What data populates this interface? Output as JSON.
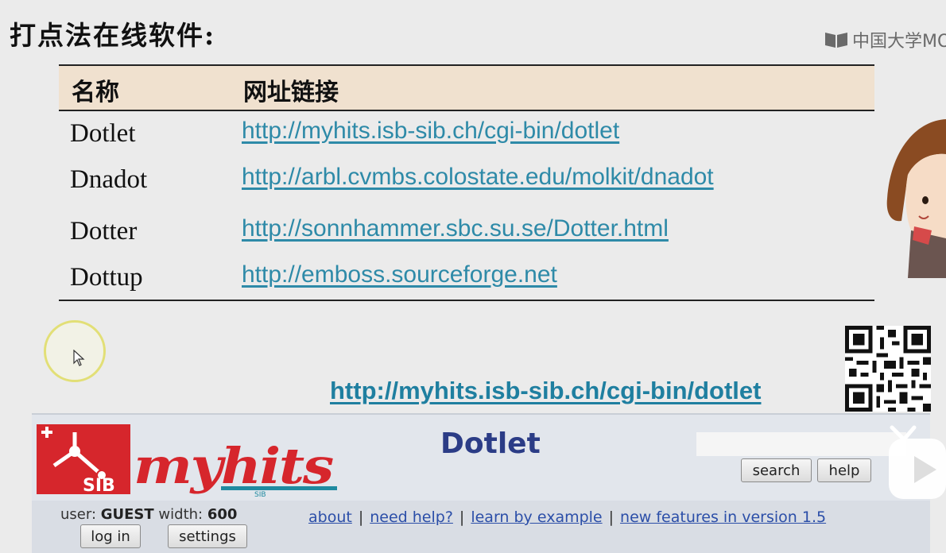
{
  "slide": {
    "title": "打点法在线软件:",
    "brand": "中国大学MO",
    "table": {
      "headers": [
        "名称",
        "网址链接"
      ],
      "rows": [
        {
          "name": "Dotlet",
          "url": "http://myhits.isb-sib.ch/cgi-bin/dotlet"
        },
        {
          "name": "Dnadot",
          "url": "http://arbl.cvmbs.colostate.edu/molkit/dnadot"
        },
        {
          "name": "Dotter",
          "url": "http://sonnhammer.sbc.su.se/Dotter.html"
        },
        {
          "name": "Dottup",
          "url": "http://emboss.sourceforge.net"
        }
      ]
    },
    "highlight_link": "http://myhits.isb-sib.ch/cgi-bin/dotlet"
  },
  "website": {
    "logo_sib": "SIB",
    "logo_myhits": "myhits",
    "logo_myhits_sub": "SIB",
    "title": "Dotlet",
    "search_value": "",
    "buttons": {
      "search": "search",
      "help": "help",
      "login": "log in",
      "settings": "settings"
    },
    "user_label": "user:",
    "user_name": "GUEST",
    "width_label": "width:",
    "width_value": "600",
    "nav": [
      "about",
      "need help?",
      "learn by example",
      "new features in version 1.5"
    ],
    "nav_sep": "|"
  },
  "colors": {
    "header_bg": "#f0e1cf",
    "link": "#2e8aa8",
    "dotlet_title": "#2b3c86",
    "sib_red": "#d6262c"
  }
}
